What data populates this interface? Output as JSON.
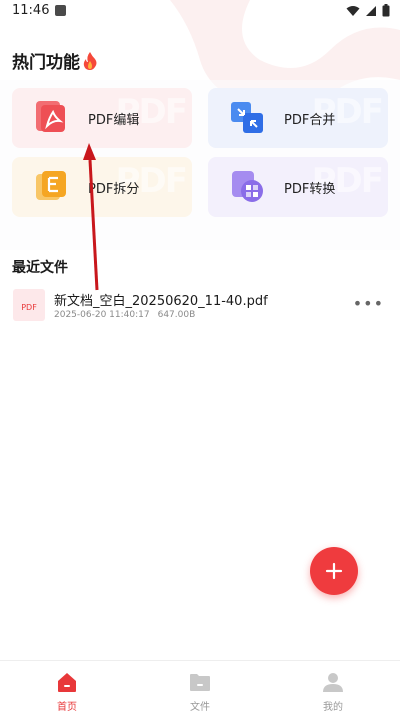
{
  "status_bar": {
    "time": "11:46"
  },
  "hot_section": {
    "title": "热门功能",
    "fire_icon": "fire-icon"
  },
  "cards": [
    {
      "label": "PDF编辑",
      "icon": "pdf-edit-icon"
    },
    {
      "label": "PDF合并",
      "icon": "pdf-merge-icon"
    },
    {
      "label": "PDF拆分",
      "icon": "pdf-split-icon"
    },
    {
      "label": "PDF转换",
      "icon": "pdf-convert-icon"
    }
  ],
  "recent": {
    "title": "最近文件",
    "files": [
      {
        "name": "新文档_空白_20250620_11-40.pdf",
        "date": "2025-06-20 11:40:17",
        "size": "647.00B",
        "badge": "PDF"
      }
    ]
  },
  "bottom_nav": {
    "items": [
      {
        "label": "首页",
        "active": true
      },
      {
        "label": "文件",
        "active": false
      },
      {
        "label": "我的",
        "active": false
      }
    ]
  },
  "colors": {
    "accent": "#ef3b3e",
    "edit_bg": "#fdeff0",
    "merge_bg": "#eef2fc",
    "split_bg": "#fdf6ea",
    "convert_bg": "#f3f0fc"
  }
}
